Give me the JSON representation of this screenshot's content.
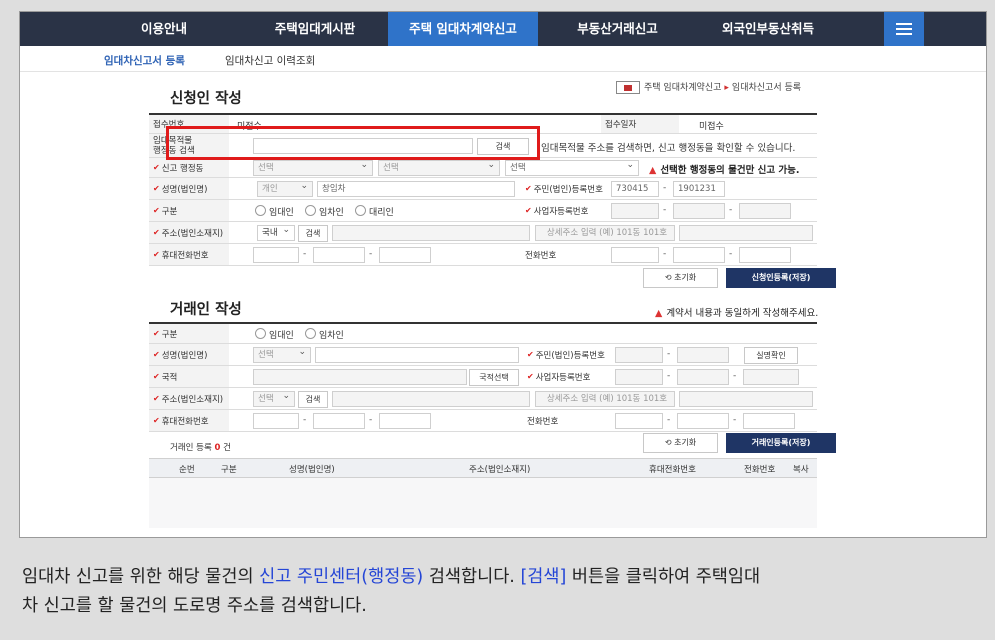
{
  "nav": {
    "items": [
      "이용안내",
      "주택임대게시판",
      "주택 임대차계약신고",
      "부동산거래신고",
      "외국인부동산취득"
    ],
    "active_index": 2
  },
  "subnav": {
    "items": [
      "임대차신고서 등록",
      "임대차신고 이력조회"
    ],
    "active_index": 0
  },
  "applicant": {
    "title": "신청인 작성",
    "breadcrumb": {
      "home": "홈",
      "path1": "주택 임대차계약신고",
      "path2": "임대차신고서 등록"
    },
    "receipt_no_label": "접수번호",
    "receipt_no_value": "미접수",
    "receipt_date_label": "접수일자",
    "receipt_date_value": "미접수",
    "office_label_line1": "임대목적물",
    "office_label_line2": "행정동 검색",
    "search_button": "검색",
    "search_hint": "임대목적물 주소를 검색하면, 신고 행정동을 확인할 수 있습니다.",
    "report_office_label": "신고 행정동",
    "select_placeholder": "선택",
    "office_warning": "선택한 행정동의 물건만 신고 가능.",
    "name_label": "성명(법인명)",
    "person_type": "개인",
    "name_value": "창임차",
    "rrn_label": "주민(법인)등록번호",
    "rrn_front": "730415",
    "rrn_back": "1901231",
    "type_label": "구분",
    "type_options": [
      "임대인",
      "임차인",
      "대리인"
    ],
    "biz_label": "사업자등록번호",
    "address_label": "주소(법인소재지)",
    "address_country": "국내",
    "address_search": "검색",
    "address_detail_placeholder": "상세주소 입력 (예) 101동 101호",
    "mobile_label": "휴대전화번호",
    "phone_label": "전화번호",
    "reset_button": "초기화",
    "save_button": "신청인등록(저장)"
  },
  "counterparty": {
    "title": "거래인 작성",
    "warning": "계약서 내용과 동일하게 작성해주세요.",
    "type_label": "구분",
    "type_options": [
      "임대인",
      "임차인"
    ],
    "name_label": "성명(법인명)",
    "select_placeholder": "선택",
    "rrn_label": "주민(법인)등록번호",
    "verify_button": "실명확인",
    "nation_label": "국적",
    "nation_button": "국적선택",
    "biz_label": "사업자등록번호",
    "address_label": "주소(법인소재지)",
    "address_search": "검색",
    "address_detail_placeholder": "상세주소 입력 (예) 101동 101호",
    "mobile_label": "휴대전화번호",
    "phone_label": "전화번호",
    "count_label": "거래인 등록",
    "count_value": "0",
    "count_unit": "건",
    "reset_button": "초기화",
    "save_button": "거래인등록(저장)",
    "table_headers": [
      "순번",
      "구분",
      "성명(법인명)",
      "주소(법인소재지)",
      "휴대전화번호",
      "전화번호",
      "복사"
    ]
  },
  "caption": {
    "line1_a": "임대차 신고를 위한 해당 물건의 ",
    "line1_b": "신고 주민센터(행정동)",
    "line1_c": " 검색합니다. ",
    "line1_d": "[검색]",
    "line1_e": " 버튼을 클릭하여 주택임대",
    "line2": "차 신고를 할 물건의 도로명 주소를 검색합니다."
  }
}
